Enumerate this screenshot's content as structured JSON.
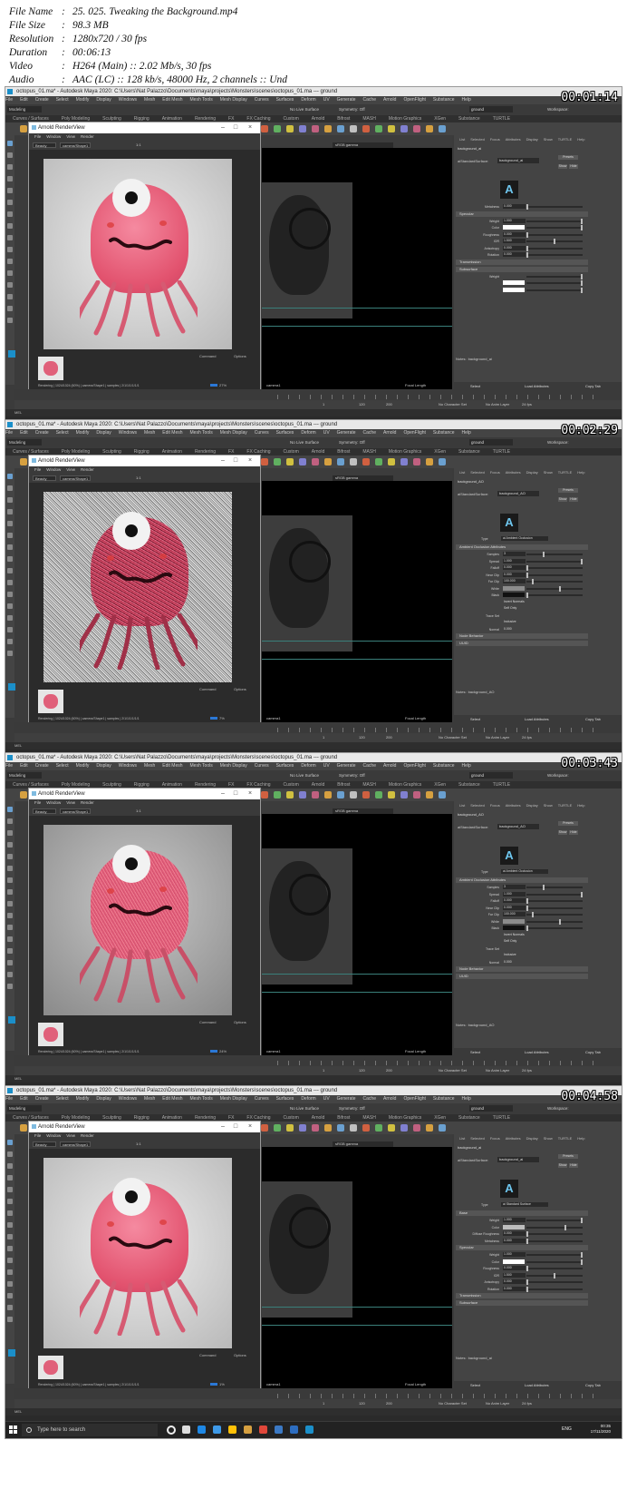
{
  "meta": {
    "rows": [
      {
        "key": "File Name",
        "value": "25. 025. Tweaking the Background.mp4"
      },
      {
        "key": "File Size",
        "value": "98.3 MB"
      },
      {
        "key": "Resolution",
        "value": "1280x720 / 30 fps"
      },
      {
        "key": "Duration",
        "value": "00:06:13"
      },
      {
        "key": "Video",
        "value": "H264 (Main) :: 2.02 Mb/s, 30 fps"
      },
      {
        "key": "Audio",
        "value": "AAC (LC) :: 128 kb/s, 48000 Hz, 2 channels :: Und"
      }
    ],
    "separator": ":"
  },
  "maya": {
    "window_title": "octopus_01.ma* - Autodesk Maya 2020: C:\\Users\\Nat Palazzo\\Documents\\maya\\projects\\Monsters\\scenes\\octopus_01.ma --- ground",
    "menus": [
      "File",
      "Edit",
      "Create",
      "Select",
      "Modify",
      "Display",
      "Windows",
      "Mesh",
      "Edit Mesh",
      "Mesh Tools",
      "Mesh Display",
      "Curves",
      "Surfaces",
      "Deform",
      "UV",
      "Generate",
      "Cache",
      "Arnold",
      "OpenFlight",
      "Substance",
      "Help"
    ],
    "mode": "Modeling",
    "shelf_tabs": [
      "Curves / Surfaces",
      "Poly Modeling",
      "Sculpting",
      "Rigging",
      "Animation",
      "Rendering",
      "FX",
      "FX Caching",
      "Custom",
      "Arnold",
      "Bifrost",
      "MASH",
      "Motion Graphics",
      "XGen",
      "Substance",
      "TURTLE"
    ],
    "no_live_surface": "No Live Surface",
    "symmetry": "Symmetry: Off",
    "object_field": "ground",
    "workspace": "Workspace:",
    "attr_tabs": [
      "List",
      "Selected",
      "Focus",
      "Attributes",
      "Display",
      "Show",
      "TURTLE",
      "Help"
    ],
    "attr_field_label": "aiStandardSurface:",
    "attr_presets": "Presets",
    "attr_show": "Show",
    "attr_hide": "Hide",
    "attr_notes_prefix": "Notes:",
    "attr_buttons": [
      "Select",
      "Load Attributes",
      "Copy Tab"
    ],
    "viewport_camera": "camera1",
    "viewport_focal": "Focal Length",
    "renderview_title": "Arnold RenderView",
    "renderview_menus": [
      "File",
      "Window",
      "View",
      "Render"
    ],
    "renderview_channel": "Beauty",
    "renderview_camera": "camera/Shape1",
    "renderview_zoom_label": "1:1",
    "renderview_cmd": "Command",
    "renderview_panel": "Options",
    "colorspace": "sRGB gamma",
    "range": {
      "start": "1",
      "end": "120",
      "end2": "200"
    },
    "no_character_set": "No Character Set",
    "no_anim_layer": "No Anim Layer",
    "fps": "24 fps",
    "cmd_label": "MEL",
    "taskbar_search": "Type here to search",
    "lang": "ENG",
    "date": "17/11/2020"
  },
  "frames": [
    {
      "timecode": "00:01:14",
      "node": "background_ai",
      "render_style": "clean",
      "status": "Rendering | 1024/1024 (60%) | camera/Shape1 | samples | 2/1/1/1/1/1/1",
      "progress": "27%",
      "clock": "00:32",
      "type_label": "",
      "type_value": "",
      "sections": [
        {
          "title": "",
          "rows": [
            {
              "label": "Metalness",
              "value": "0.000",
              "knob": 0.0
            }
          ]
        },
        {
          "title": "Specular",
          "rows": [
            {
              "label": "Weight",
              "value": "1.000",
              "knob": 1.0
            },
            {
              "label": "Color",
              "value": "",
              "swatch": "#ffffff",
              "knob": 1.0
            },
            {
              "label": "Roughness",
              "value": "0.000",
              "knob": 0.0
            },
            {
              "label": "IOR",
              "value": "1.500",
              "knob": 0.5
            },
            {
              "label": "Anisotropy",
              "value": "0.000",
              "knob": 0.0
            },
            {
              "label": "Rotation",
              "value": "0.000",
              "knob": 0.0
            }
          ]
        },
        {
          "title": "Transmission",
          "rows": []
        },
        {
          "title": "Subsurface",
          "rows": [
            {
              "label": "Weight",
              "value": "",
              "swatch": "",
              "knob": 1.0
            },
            {
              "label": "",
              "value": "",
              "swatch": "#ffffff",
              "knob": 1.0
            },
            {
              "label": "",
              "value": "",
              "swatch": "#ffffff",
              "knob": 1.0
            }
          ]
        }
      ],
      "notes": "background_ai"
    },
    {
      "timecode": "00:02:29",
      "node": "background_AO",
      "render_style": "noisy",
      "status": "Rendering | 1024/1024 (60%) | camera/Shape1 | samples | 2/1/1/1/1/1/1",
      "progress": "7%",
      "clock": "00:33",
      "type_label": "Type",
      "type_value": "ai Ambient Occlusion",
      "sections": [
        {
          "title": "Ambient Occlusion Attributes",
          "rows": [
            {
              "label": "Samples",
              "value": "3",
              "knob": 0.3
            },
            {
              "label": "Spread",
              "value": "1.000",
              "knob": 1.0
            },
            {
              "label": "Falloff",
              "value": "0.000",
              "knob": 0.0
            },
            {
              "label": "Near Clip",
              "value": "0.000",
              "knob": 0.0
            },
            {
              "label": "Far Clip",
              "value": "100.000",
              "knob": 0.1
            },
            {
              "label": "White",
              "value": "",
              "swatch": "#8c8c8c",
              "knob": 0.6
            },
            {
              "label": "Black",
              "value": "",
              "swatch": "#111111",
              "knob": 0.0
            },
            {
              "label": "",
              "value": "Invert Normals",
              "knob": -1
            },
            {
              "label": "",
              "value": "Self Only",
              "knob": -1
            },
            {
              "label": "Trace Set",
              "value": "",
              "knob": -1
            },
            {
              "label": "",
              "value": "Inclusive",
              "knob": -1
            },
            {
              "label": "Normal",
              "value": "0.000",
              "knob": -1
            }
          ]
        },
        {
          "title": "Node Behavior",
          "rows": []
        },
        {
          "title": "UUID",
          "rows": []
        }
      ],
      "notes": "background_AO"
    },
    {
      "timecode": "00:03:43",
      "node": "background_AO",
      "render_style": "medium",
      "status": "Rendering | 1024/1024 (60%) | camera/Shape1 | samples | 2/1/1/1/1/1/1",
      "progress": "24%",
      "clock": "00:34",
      "type_label": "Type",
      "type_value": "ai Ambient Occlusion",
      "sections": [
        {
          "title": "Ambient Occlusion Attributes",
          "rows": [
            {
              "label": "Samples",
              "value": "3",
              "knob": 0.3
            },
            {
              "label": "Spread",
              "value": "1.000",
              "knob": 1.0
            },
            {
              "label": "Falloff",
              "value": "0.000",
              "knob": 0.0
            },
            {
              "label": "Near Clip",
              "value": "0.000",
              "knob": 0.0
            },
            {
              "label": "Far Clip",
              "value": "100.000",
              "knob": 0.1
            },
            {
              "label": "White",
              "value": "",
              "swatch": "#8c8c8c",
              "knob": 0.6
            },
            {
              "label": "Black",
              "value": "",
              "swatch": "#111111",
              "knob": 0.0
            },
            {
              "label": "",
              "value": "Invert Normals",
              "knob": -1
            },
            {
              "label": "",
              "value": "Self Only",
              "knob": -1
            },
            {
              "label": "Trace Set",
              "value": "",
              "knob": -1
            },
            {
              "label": "",
              "value": "Inclusive",
              "knob": -1
            },
            {
              "label": "Normal",
              "value": "0.000",
              "knob": -1
            }
          ]
        },
        {
          "title": "Node Behavior",
          "rows": []
        },
        {
          "title": "UUID",
          "rows": []
        }
      ],
      "notes": "background_AO"
    },
    {
      "timecode": "00:04:58",
      "node": "background_ai",
      "render_style": "clean",
      "status": "Rendering | 1024/1024 (60%) | camera/Shape1 | samples | 2/1/1/1/1/1/1",
      "progress": "1%",
      "clock": "00:35",
      "type_label": "Type",
      "type_value": "ai Standard Surface",
      "sections": [
        {
          "title": "Base",
          "rows": [
            {
              "label": "Weight",
              "value": "1.000",
              "knob": 1.0
            },
            {
              "label": "Color",
              "value": "",
              "swatch": "#bdbdbd",
              "knob": 0.7
            },
            {
              "label": "Diffuse Roughness",
              "value": "0.000",
              "knob": 0.0
            },
            {
              "label": "Metalness",
              "value": "0.000",
              "knob": 0.0
            }
          ]
        },
        {
          "title": "Specular",
          "rows": [
            {
              "label": "Weight",
              "value": "1.000",
              "knob": 1.0
            },
            {
              "label": "Color",
              "value": "",
              "swatch": "#ffffff",
              "knob": 1.0
            },
            {
              "label": "Roughness",
              "value": "0.000",
              "knob": 0.0
            },
            {
              "label": "IOR",
              "value": "1.500",
              "knob": 0.5
            },
            {
              "label": "Anisotropy",
              "value": "0.000",
              "knob": 0.0
            },
            {
              "label": "Rotation",
              "value": "0.000",
              "knob": 0.0
            }
          ]
        },
        {
          "title": "Transmission",
          "rows": []
        },
        {
          "title": "Subsurface",
          "rows": []
        }
      ],
      "notes": "background_ai"
    }
  ]
}
